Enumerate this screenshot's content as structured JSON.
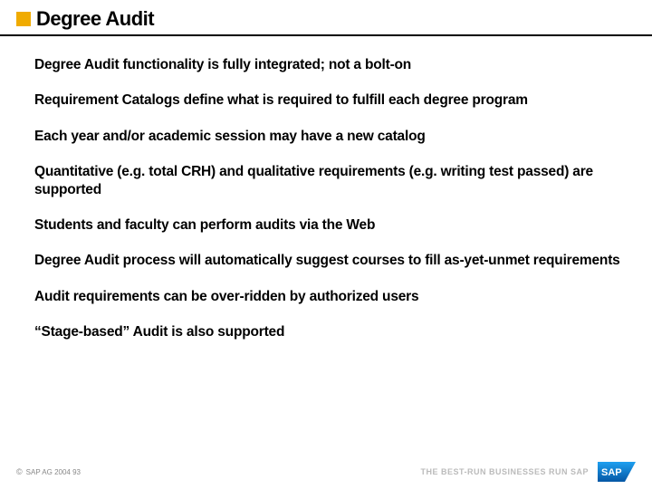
{
  "header": {
    "title": "Degree Audit"
  },
  "bullets": [
    "Degree Audit functionality is fully integrated; not a bolt-on",
    "Requirement Catalogs define what is required to fulfill each degree program",
    "Each year and/or academic session may have a new catalog",
    "Quantitative (e.g. total CRH) and qualitative requirements (e.g. writing test passed) are supported",
    "Students and faculty can perform audits via the Web",
    "Degree Audit process will automatically suggest courses to fill as-yet-unmet requirements",
    "Audit requirements can be over-ridden by authorized users",
    "“Stage-based” Audit is also supported"
  ],
  "footer": {
    "copyright": "SAP AG 2004  93",
    "tagline": "THE BEST-RUN BUSINESSES RUN SAP",
    "logo_text": "SAP"
  },
  "colors": {
    "accent": "#f0ab00",
    "sap_blue": "#0a6ed1"
  }
}
